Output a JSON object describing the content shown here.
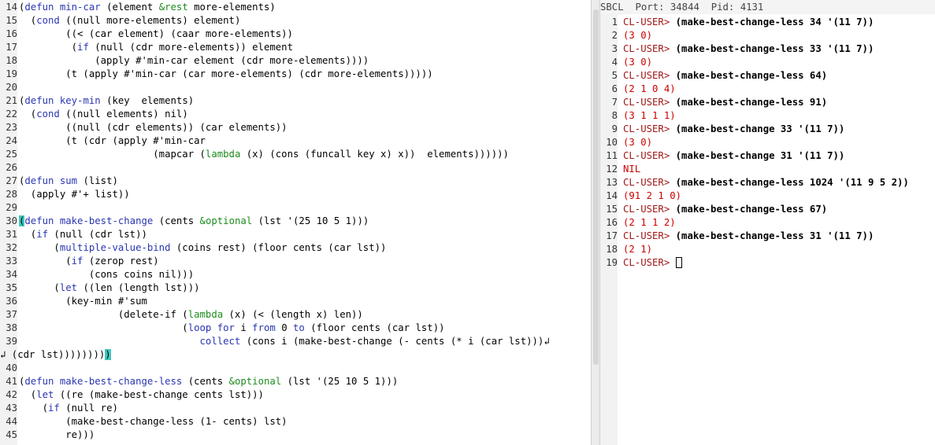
{
  "editor": {
    "lines": [
      {
        "n": "14",
        "segs": [
          [
            "(",
            "",
            ""
          ],
          [
            "defun",
            "kw",
            ""
          ],
          [
            " ",
            "",
            ""
          ],
          [
            "min-car",
            "kw",
            ""
          ],
          [
            " (element ",
            "",
            ""
          ],
          [
            "&rest",
            "op",
            ""
          ],
          [
            " more-elements)",
            "",
            ""
          ]
        ]
      },
      {
        "n": "15",
        "segs": [
          [
            "  (",
            "",
            ""
          ],
          [
            "cond",
            "kw",
            ""
          ],
          [
            " ((null more-elements) element)",
            "",
            ""
          ]
        ]
      },
      {
        "n": "16",
        "segs": [
          [
            "        ((< (car element) (caar more-elements))",
            "",
            ""
          ]
        ]
      },
      {
        "n": "17",
        "segs": [
          [
            "         (",
            "",
            ""
          ],
          [
            "if",
            "kw",
            ""
          ],
          [
            " (null (cdr more-elements)) element",
            "",
            ""
          ]
        ]
      },
      {
        "n": "18",
        "segs": [
          [
            "             (apply #'min-car element (cdr more-elements))))",
            "",
            ""
          ]
        ]
      },
      {
        "n": "19",
        "segs": [
          [
            "        (t (apply #'min-car (car more-elements) (cdr more-elements)))))",
            "",
            ""
          ]
        ]
      },
      {
        "n": "20",
        "segs": [
          [
            "",
            "",
            ""
          ]
        ]
      },
      {
        "n": "21",
        "segs": [
          [
            "(",
            "",
            ""
          ],
          [
            "defun",
            "kw",
            ""
          ],
          [
            " ",
            "",
            ""
          ],
          [
            "key-min",
            "kw",
            ""
          ],
          [
            " (key  elements)",
            "",
            ""
          ]
        ]
      },
      {
        "n": "22",
        "segs": [
          [
            "  (",
            "",
            ""
          ],
          [
            "cond",
            "kw",
            ""
          ],
          [
            " ((null elements) nil)",
            "",
            ""
          ]
        ]
      },
      {
        "n": "23",
        "segs": [
          [
            "        ((null (cdr elements)) (car elements))",
            "",
            ""
          ]
        ]
      },
      {
        "n": "24",
        "segs": [
          [
            "        (t (cdr (apply #'min-car",
            "",
            ""
          ]
        ]
      },
      {
        "n": "25",
        "segs": [
          [
            "                       (mapcar (",
            "",
            ""
          ],
          [
            "lambda",
            "op",
            ""
          ],
          [
            " (x) (cons (funcall key x) x))  elements))))))",
            "",
            ""
          ]
        ]
      },
      {
        "n": "26",
        "segs": [
          [
            "",
            "",
            ""
          ]
        ]
      },
      {
        "n": "27",
        "segs": [
          [
            "(",
            "",
            ""
          ],
          [
            "defun",
            "kw",
            ""
          ],
          [
            " ",
            "",
            ""
          ],
          [
            "sum",
            "kw",
            ""
          ],
          [
            " (list)",
            "",
            ""
          ]
        ]
      },
      {
        "n": "28",
        "segs": [
          [
            "  (apply #'+ list))",
            "",
            ""
          ]
        ]
      },
      {
        "n": "29",
        "segs": [
          [
            "",
            "",
            ""
          ]
        ]
      },
      {
        "n": "30",
        "segs": [
          [
            "(",
            "",
            "hl"
          ],
          [
            "defun",
            "kw",
            ""
          ],
          [
            " ",
            "",
            ""
          ],
          [
            "make-best-change",
            "kw",
            ""
          ],
          [
            " (cents ",
            "",
            ""
          ],
          [
            "&optional",
            "op",
            ""
          ],
          [
            " (lst '(25 10 5 1)))",
            "",
            ""
          ]
        ]
      },
      {
        "n": "31",
        "segs": [
          [
            "  (",
            "",
            ""
          ],
          [
            "if",
            "kw",
            ""
          ],
          [
            " (null (cdr lst))",
            "",
            ""
          ]
        ]
      },
      {
        "n": "32",
        "segs": [
          [
            "      (",
            "",
            ""
          ],
          [
            "multiple-value-bind",
            "kw",
            ""
          ],
          [
            " (coins rest) (floor cents (car lst))",
            "",
            ""
          ]
        ]
      },
      {
        "n": "33",
        "segs": [
          [
            "        (",
            "",
            ""
          ],
          [
            "if",
            "kw",
            ""
          ],
          [
            " (zerop rest)",
            "",
            ""
          ]
        ]
      },
      {
        "n": "34",
        "segs": [
          [
            "            (cons coins nil)))",
            "",
            ""
          ]
        ]
      },
      {
        "n": "35",
        "segs": [
          [
            "      (",
            "",
            ""
          ],
          [
            "let",
            "kw",
            ""
          ],
          [
            " ((len (length lst)))",
            "",
            ""
          ]
        ]
      },
      {
        "n": "36",
        "segs": [
          [
            "        (key-min #'sum",
            "",
            ""
          ]
        ]
      },
      {
        "n": "37",
        "segs": [
          [
            "                 (delete-if (",
            "",
            ""
          ],
          [
            "lambda",
            "op",
            ""
          ],
          [
            " (x) (< (length x) len))",
            "",
            ""
          ]
        ]
      },
      {
        "n": "38",
        "segs": [
          [
            "                            (",
            "",
            ""
          ],
          [
            "loop",
            "kw",
            ""
          ],
          [
            " ",
            "",
            ""
          ],
          [
            "for",
            "kw",
            ""
          ],
          [
            " i ",
            "",
            ""
          ],
          [
            "from",
            "kw",
            ""
          ],
          [
            " 0 ",
            "",
            ""
          ],
          [
            "to",
            "kw",
            ""
          ],
          [
            " (floor cents (car lst))",
            "",
            ""
          ]
        ]
      },
      {
        "n": "39",
        "segs": [
          [
            "                               ",
            "",
            ""
          ],
          [
            "collect",
            "kw",
            ""
          ],
          [
            " (cons i (make-best-change (- cents (* i (car lst)))",
            "",
            ""
          ]
        ]
      },
      {
        "n": "",
        "segs": [
          [
            " (cdr lst))))))))",
            "",
            ""
          ],
          [
            ")",
            "",
            "hl"
          ]
        ]
      },
      {
        "n": "40",
        "segs": [
          [
            "",
            "",
            ""
          ]
        ]
      },
      {
        "n": "41",
        "segs": [
          [
            "(",
            "",
            ""
          ],
          [
            "defun",
            "kw",
            ""
          ],
          [
            " ",
            "",
            ""
          ],
          [
            "make-best-change-less",
            "kw",
            ""
          ],
          [
            " (cents ",
            "",
            ""
          ],
          [
            "&optional",
            "op",
            ""
          ],
          [
            " (lst '(25 10 5 1)))",
            "",
            ""
          ]
        ]
      },
      {
        "n": "42",
        "segs": [
          [
            "  (",
            "",
            ""
          ],
          [
            "let",
            "kw",
            ""
          ],
          [
            " ((re (make-best-change cents lst)))",
            "",
            ""
          ]
        ]
      },
      {
        "n": "43",
        "segs": [
          [
            "    (",
            "",
            ""
          ],
          [
            "if",
            "kw",
            ""
          ],
          [
            " (null re)",
            "",
            ""
          ]
        ]
      },
      {
        "n": "44",
        "segs": [
          [
            "        (make-best-change-less (1- cents) lst)",
            "",
            ""
          ]
        ]
      },
      {
        "n": "45",
        "segs": [
          [
            "        re)))",
            "",
            ""
          ]
        ]
      }
    ],
    "wrap_glyph": "↲"
  },
  "repl": {
    "modeline": {
      "impl": "SBCL",
      "port_label": "Port: 34844",
      "pid_label": "Pid: 4131"
    },
    "prompt": "CL-USER>",
    "lines": [
      {
        "n": "1",
        "kind": "in",
        "text": "(make-best-change-less 34 '(11 7))"
      },
      {
        "n": "2",
        "kind": "out",
        "text": "(3 0)"
      },
      {
        "n": "3",
        "kind": "in",
        "text": "(make-best-change-less 33 '(11 7))"
      },
      {
        "n": "4",
        "kind": "out",
        "text": "(3 0)"
      },
      {
        "n": "5",
        "kind": "in",
        "text": "(make-best-change-less 64)"
      },
      {
        "n": "6",
        "kind": "out",
        "text": "(2 1 0 4)"
      },
      {
        "n": "7",
        "kind": "in",
        "text": "(make-best-change-less 91)"
      },
      {
        "n": "8",
        "kind": "out",
        "text": "(3 1 1 1)"
      },
      {
        "n": "9",
        "kind": "in",
        "text": "(make-best-change 33 '(11 7))"
      },
      {
        "n": "10",
        "kind": "out",
        "text": "(3 0)"
      },
      {
        "n": "11",
        "kind": "in",
        "text": "(make-best-change 31 '(11 7))"
      },
      {
        "n": "12",
        "kind": "out",
        "text": "NIL"
      },
      {
        "n": "13",
        "kind": "in",
        "text": "(make-best-change-less 1024 '(11 9 5 2))"
      },
      {
        "n": "14",
        "kind": "out",
        "text": "(91 2 1 0)"
      },
      {
        "n": "15",
        "kind": "in",
        "text": "(make-best-change-less 67)"
      },
      {
        "n": "16",
        "kind": "out",
        "text": "(2 1 1 2)"
      },
      {
        "n": "17",
        "kind": "in",
        "text": "(make-best-change-less 31 '(11 7))"
      },
      {
        "n": "18",
        "kind": "out",
        "text": "(2 1)"
      },
      {
        "n": "19",
        "kind": "prompt",
        "text": ""
      }
    ]
  }
}
